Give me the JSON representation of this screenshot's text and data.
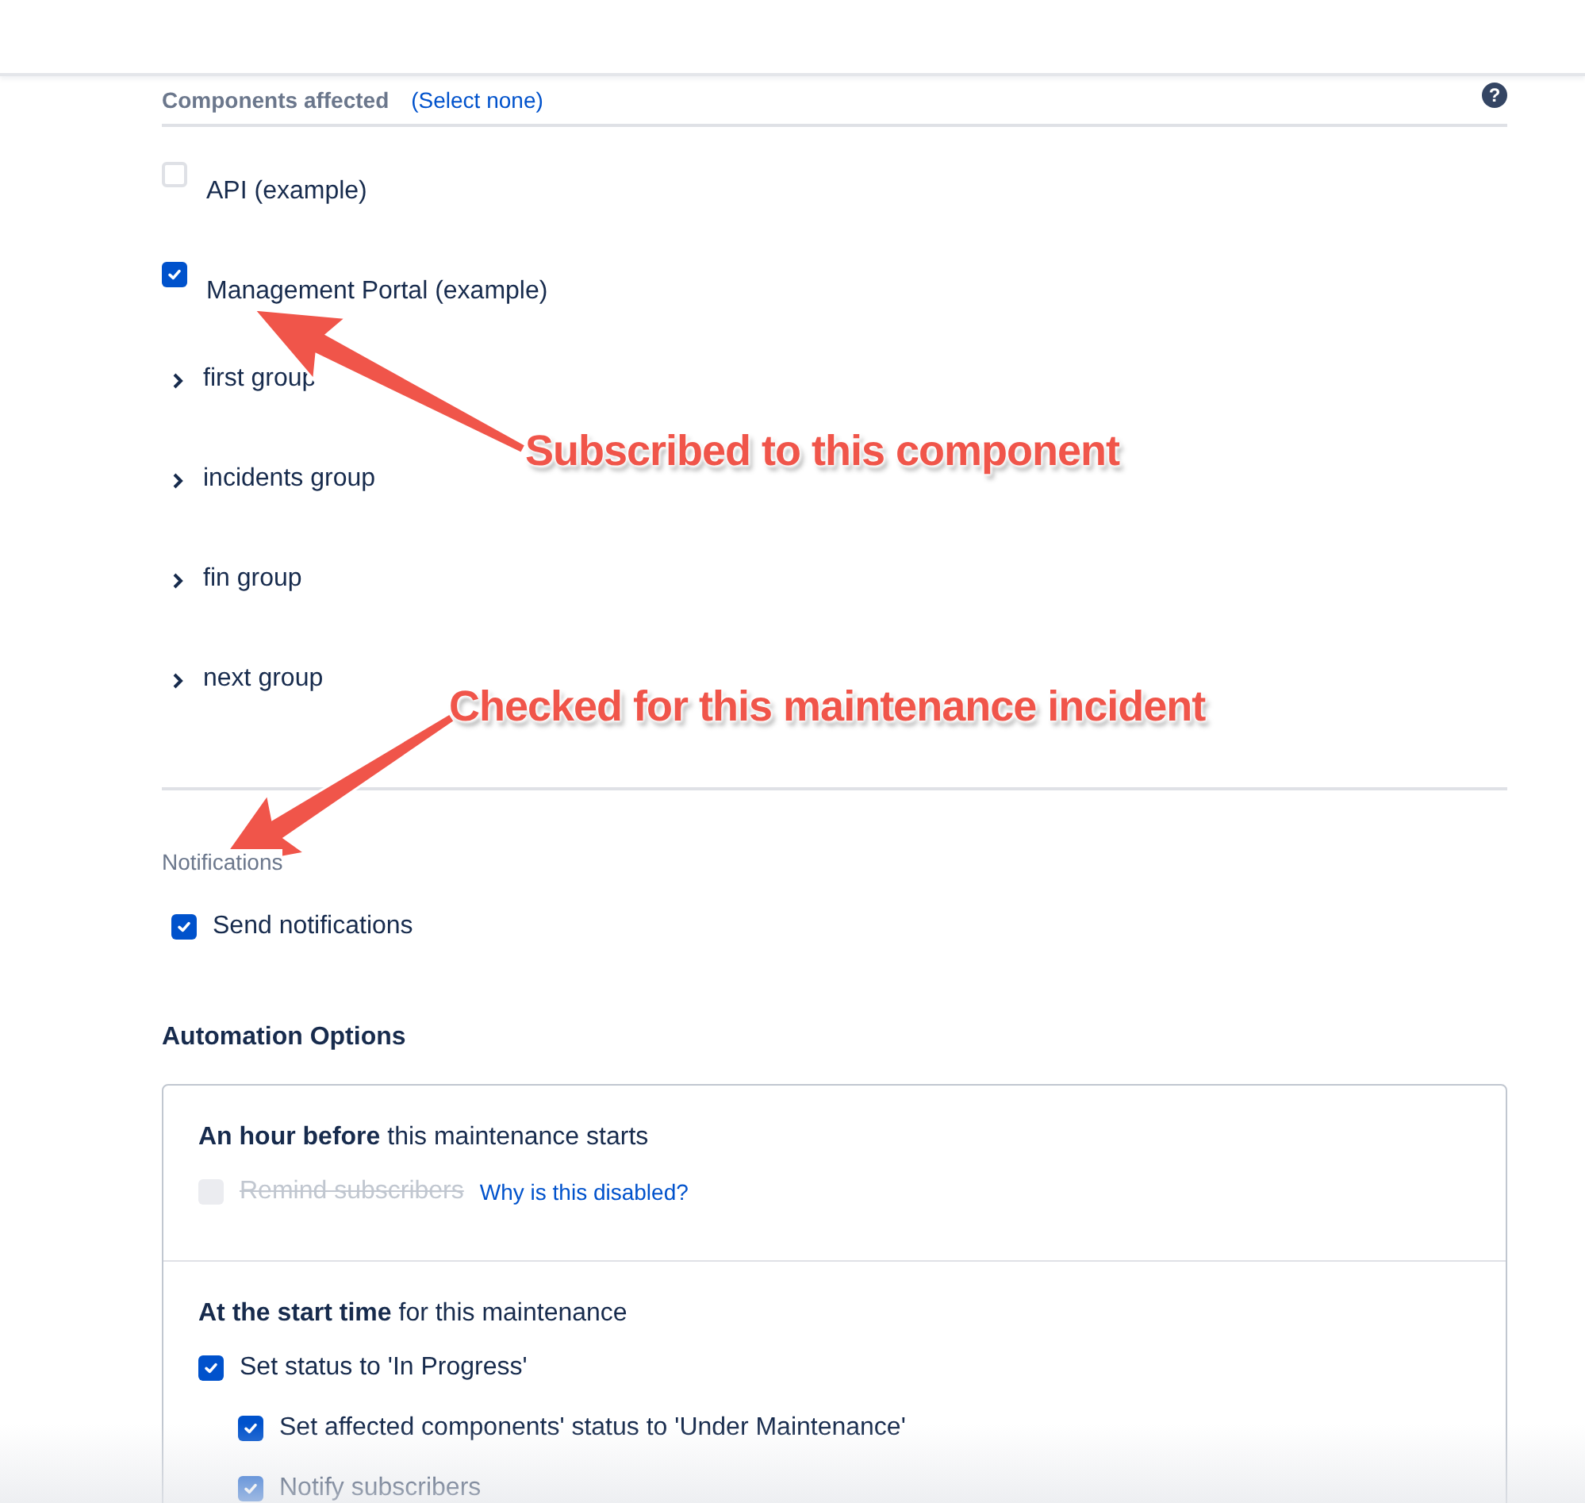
{
  "components": {
    "title": "Components affected",
    "select_none": "(Select none)",
    "help": "?",
    "items": [
      {
        "kind": "checkbox",
        "label": "API (example)",
        "checked": false
      },
      {
        "kind": "checkbox",
        "label": "Management Portal (example)",
        "checked": true
      },
      {
        "kind": "group",
        "label": "first group",
        "expanded": false
      },
      {
        "kind": "group",
        "label": "incidents group",
        "expanded": false
      },
      {
        "kind": "group",
        "label": "fin group",
        "expanded": false
      },
      {
        "kind": "group",
        "label": "next group",
        "expanded": false
      }
    ]
  },
  "notifications": {
    "title": "Notifications",
    "options": [
      {
        "label": "Send notifications",
        "checked": true,
        "disabled": false
      }
    ]
  },
  "automation": {
    "title": "Automation Options",
    "sections": [
      {
        "heading": "**An hour before** this maintenance starts",
        "options": [
          {
            "label": "Remind subscribers",
            "checked": false,
            "disabled": true,
            "link": "Why is this disabled?"
          }
        ]
      },
      {
        "heading": "**At the start time** for this maintenance",
        "options": [
          {
            "label": "Set status to 'In Progress'",
            "checked": true,
            "disabled": false,
            "children": [
              {
                "label": "Set affected components' status to 'Under Maintenance'",
                "checked": true,
                "disabled": false
              },
              {
                "label": "Notify subscribers",
                "checked": true,
                "disabled": false
              }
            ]
          }
        ]
      }
    ]
  },
  "annotations": [
    {
      "text": "Subscribed to this component"
    },
    {
      "text": "Checked for this maintenance incident"
    }
  ]
}
